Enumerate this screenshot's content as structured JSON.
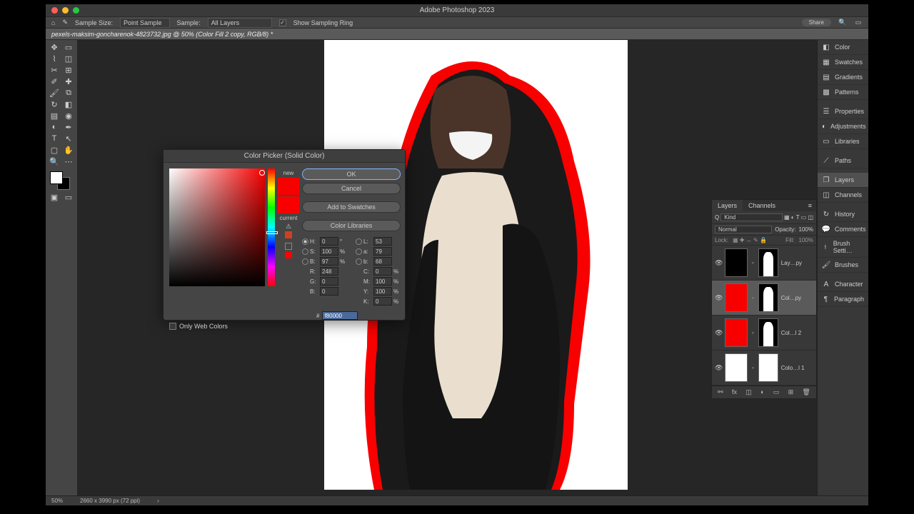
{
  "app_title": "Adobe Photoshop 2023",
  "options_bar": {
    "sample_size_label": "Sample Size:",
    "sample_size_value": "Point Sample",
    "sample_label": "Sample:",
    "sample_value": "All Layers",
    "show_ring": "Show Sampling Ring",
    "pill": "Share"
  },
  "doc_tab": "pexels-maksim-goncharenok-4823732.jpg @ 50% (Color Fill 2 copy, RGB/8) *",
  "dock": {
    "color": "Color",
    "swatches": "Swatches",
    "gradients": "Gradients",
    "patterns": "Patterns",
    "properties": "Properties",
    "adjustments": "Adjustments",
    "libraries": "Libraries",
    "paths": "Paths",
    "layers": "Layers",
    "channels": "Channels",
    "history": "History",
    "comments": "Comments",
    "brush": "Brush Setti…",
    "brushes": "Brushes",
    "character": "Character",
    "paragraph": "Paragraph"
  },
  "layers_panel": {
    "tab_layers": "Layers",
    "tab_channels": "Channels",
    "kind": "Kind",
    "opacity_label": "Opacity:",
    "opacity": "100%",
    "fill_label": "Fill:",
    "fill": "100%",
    "lock": "Lock:",
    "items": [
      {
        "name": "Lay…py",
        "visible": true,
        "fill": "#000",
        "mask": "sil"
      },
      {
        "name": "Col…py",
        "visible": true,
        "fill": "#f80000",
        "mask": "sil",
        "selected": true
      },
      {
        "name": "Col…l 2",
        "visible": true,
        "fill": "#f80000",
        "mask": "sil"
      },
      {
        "name": "Colo…l 1",
        "visible": true,
        "fill": "#fff",
        "mask": "white"
      }
    ]
  },
  "status": {
    "zoom": "50%",
    "dims": "2660 x 3990 px (72 ppi)"
  },
  "color_picker": {
    "title": "Color Picker (Solid Color)",
    "new": "new",
    "current": "current",
    "ok": "OK",
    "cancel": "Cancel",
    "add": "Add to Swatches",
    "libs": "Color Libraries",
    "web_only": "Only Web Colors",
    "H": "0",
    "S": "100",
    "Bv": "97",
    "R": "248",
    "G": "0",
    "Bb": "0",
    "L": "53",
    "a": "79",
    "b": "68",
    "C": "0",
    "M": "100",
    "Y": "100",
    "K": "0",
    "hex": "f80000",
    "deg": "°",
    "pct": "%"
  }
}
